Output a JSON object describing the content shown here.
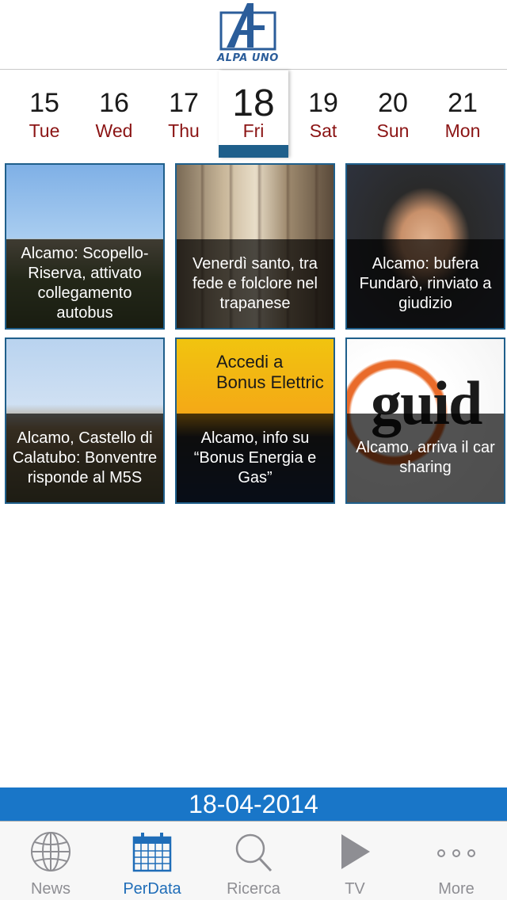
{
  "app": {
    "logo_text": "ALPA UNO"
  },
  "date_strip": {
    "days": [
      {
        "num": "15",
        "weekday": "Tue"
      },
      {
        "num": "16",
        "weekday": "Wed"
      },
      {
        "num": "17",
        "weekday": "Thu"
      },
      {
        "num": "18",
        "weekday": "Fri",
        "selected": true
      },
      {
        "num": "19",
        "weekday": "Sat"
      },
      {
        "num": "20",
        "weekday": "Sun"
      },
      {
        "num": "21",
        "weekday": "Mon"
      }
    ]
  },
  "articles": [
    {
      "caption": "Alcamo: Scopello-Riserva, attivato collegamento autobus",
      "image": "mountain-photo"
    },
    {
      "caption": "Venerdì santo, tra fede e folclore nel trapanese",
      "image": "street-procession-photo"
    },
    {
      "caption": "Alcamo: bufera Fundarò, rinviato a giudizio",
      "image": "portrait-photo"
    },
    {
      "caption": "Alcamo, Castello di Calatubo: Bonventre risponde al M5S",
      "image": "castle-photo"
    },
    {
      "caption": "Alcamo, info su “Bonus Energia e Gas”",
      "image": "bonus-banner",
      "image_text": "Accedi a\nBonus Elettric"
    },
    {
      "caption": "Alcamo, arriva il car sharing",
      "image": "guida-logo",
      "image_text": "guid"
    }
  ],
  "selected_date": "18-04-2014",
  "tab_bar": {
    "tabs": [
      {
        "label": "News",
        "icon": "globe-icon"
      },
      {
        "label": "PerData",
        "icon": "calendar-icon",
        "active": true
      },
      {
        "label": "Ricerca",
        "icon": "search-icon"
      },
      {
        "label": "TV",
        "icon": "play-icon"
      },
      {
        "label": "More",
        "icon": "more-icon"
      }
    ]
  },
  "colors": {
    "accent_blue": "#1976c8",
    "tile_border": "#1f5f8b",
    "weekday_red": "#8b1414",
    "tab_active": "#1f6db8",
    "tab_inactive": "#8e8e93"
  }
}
